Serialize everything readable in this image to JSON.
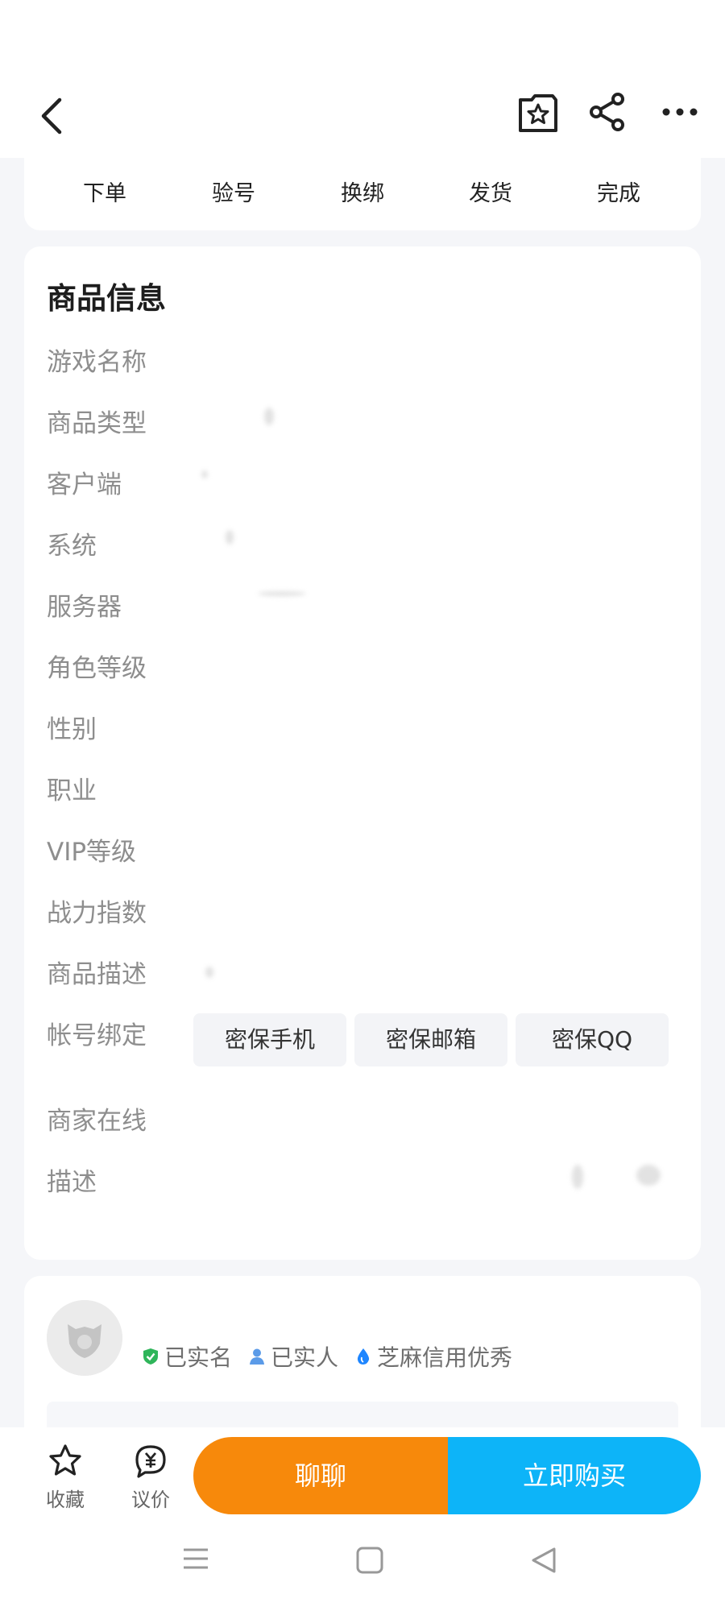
{
  "header": {
    "icons": [
      "back-icon",
      "favorite-star-icon",
      "share-icon",
      "more-icon"
    ]
  },
  "steps": [
    "下单",
    "验号",
    "换绑",
    "发货",
    "完成"
  ],
  "product_info": {
    "title": "商品信息",
    "labels": [
      "游戏名称",
      "商品类型",
      "客户端",
      "系统",
      "服务器",
      "角色等级",
      "性别",
      "职业",
      "VIP等级",
      "战力指数",
      "商品描述",
      "帐号绑定",
      "商家在线",
      "描述"
    ],
    "account_binding": [
      "密保手机",
      "密保邮箱",
      "密保QQ"
    ]
  },
  "seller": {
    "badges": [
      {
        "text": "已实名",
        "icon": "verified-shield-icon",
        "color": "#2fb55a"
      },
      {
        "text": "已实人",
        "icon": "person-icon",
        "color": "#5b9be8"
      },
      {
        "text": "芝麻信用优秀",
        "icon": "sesame-drop-icon",
        "color": "#1e86ff"
      }
    ]
  },
  "bottom": {
    "collect_label": "收藏",
    "bargain_label": "议价",
    "chat_label": "聊聊",
    "buy_label": "立即购买"
  },
  "colors": {
    "chat": "#f7890b",
    "buy": "#0db4f8",
    "page_bg": "#f5f6f9"
  }
}
